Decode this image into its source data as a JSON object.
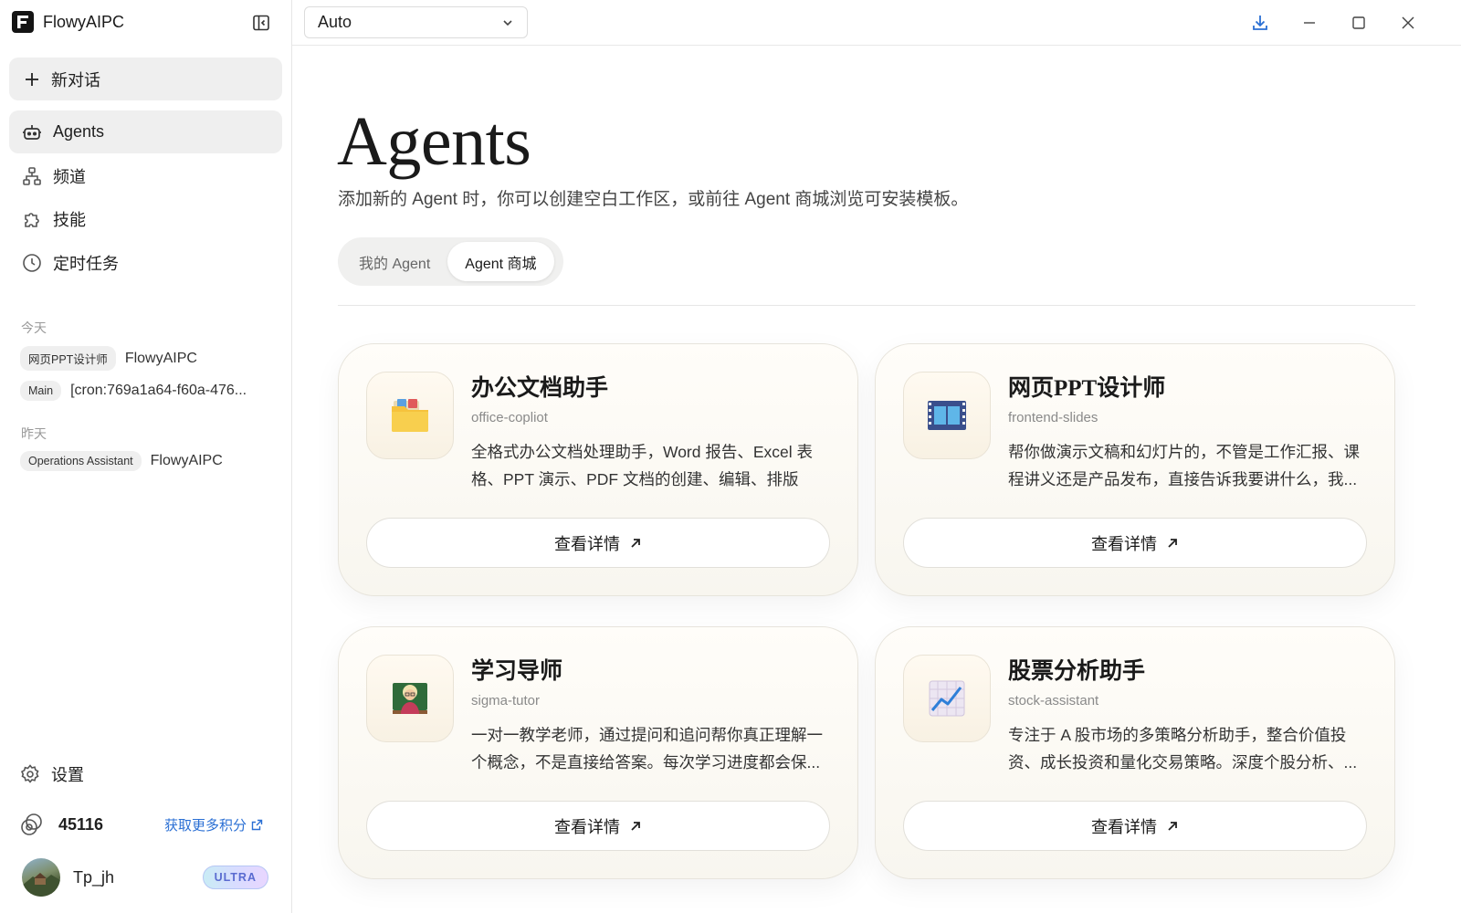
{
  "app": {
    "name": "FlowyAIPC"
  },
  "sidebar": {
    "new_chat": "新对话",
    "nav": [
      {
        "label": "Agents",
        "icon": "robot-icon"
      },
      {
        "label": "频道",
        "icon": "hierarchy-icon"
      },
      {
        "label": "技能",
        "icon": "puzzle-icon"
      },
      {
        "label": "定时任务",
        "icon": "clock-icon"
      }
    ],
    "sections": [
      {
        "label": "今天",
        "items": [
          {
            "tag": "网页PPT设计师",
            "text": "FlowyAIPC"
          },
          {
            "tag": "Main",
            "text": "[cron:769a1a64-f60a-476..."
          }
        ]
      },
      {
        "label": "昨天",
        "items": [
          {
            "tag": "Operations Assistant",
            "text": "FlowyAIPC"
          }
        ]
      }
    ],
    "settings": "设置",
    "credits": {
      "value": "45116",
      "link": "获取更多积分"
    },
    "user": {
      "name": "Tp_jh",
      "badge": "ULTRA"
    }
  },
  "topbar": {
    "model": "Auto"
  },
  "main": {
    "title": "Agents",
    "subtitle": "添加新的 Agent 时，你可以创建空白工作区，或前往 Agent 商城浏览可安装模板。",
    "tabs": [
      "我的 Agent",
      "Agent 商城"
    ],
    "active_tab": 1,
    "cards": [
      {
        "title": "办公文档助手",
        "slug": "office-copliot",
        "desc": "全格式办公文档处理助手，Word 报告、Excel 表格、PPT 演示、PDF 文档的创建、编辑、排版都...",
        "button": "查看详情",
        "icon": "folder-icon"
      },
      {
        "title": "网页PPT设计师",
        "slug": "frontend-slides",
        "desc": "帮你做演示文稿和幻灯片的，不管是工作汇报、课程讲义还是产品发布，直接告诉我要讲什么，我...",
        "button": "查看详情",
        "icon": "film-icon"
      },
      {
        "title": "学习导师",
        "slug": "sigma-tutor",
        "desc": "一对一教学老师，通过提问和追问帮你真正理解一个概念，不是直接给答案。每次学习进度都会保...",
        "button": "查看详情",
        "icon": "teacher-icon"
      },
      {
        "title": "股票分析助手",
        "slug": "stock-assistant",
        "desc": "专注于 A 股市场的多策略分析助手，整合价值投资、成长投资和量化交易策略。深度个股分析、...",
        "button": "查看详情",
        "icon": "chart-up-icon"
      }
    ]
  },
  "colors": {
    "accent_link": "#2a6fd4",
    "badge_text": "#5a6bd0"
  }
}
